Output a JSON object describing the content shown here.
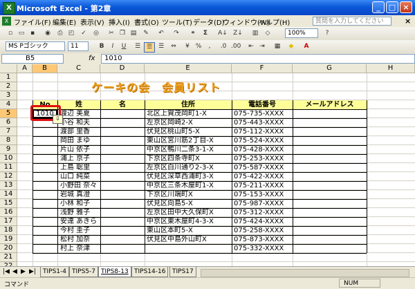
{
  "window": {
    "title": "Microsoft Excel - 第2章",
    "app_icon": "X"
  },
  "menu": {
    "items": [
      "ファイル(F)",
      "編集(E)",
      "表示(V)",
      "挿入(I)",
      "書式(O)",
      "ツール(T)",
      "データ(D)",
      "ウィンドウ(W)",
      "ヘルプ(H)"
    ],
    "help_placeholder": "質問を入力してください",
    "close_glyph": "×"
  },
  "toolbar": {
    "zoom": "100%",
    "font_name": "MS Pゴシック",
    "font_size": "11",
    "bold": "B",
    "italic": "I",
    "underline": "U",
    "percent": "%",
    "comma": ",",
    "sum": "Σ",
    "sort_asc": "A↓",
    "sort_desc": "Z↓"
  },
  "formula_bar": {
    "name_box": "B5",
    "fx": "fx",
    "value": "1010"
  },
  "columns": [
    "A",
    "B",
    "C",
    "D",
    "E",
    "F",
    "G",
    "H"
  ],
  "rows": [
    "1",
    "2",
    "3",
    "4",
    "5",
    "6",
    "7",
    "8",
    "9",
    "10",
    "11",
    "12",
    "13",
    "14",
    "15",
    "16",
    "17",
    "18",
    "19",
    "20",
    "21",
    "22"
  ],
  "sheet": {
    "title": "ケーキの会　会員リスト",
    "headers": {
      "no": "No",
      "sei": "姓",
      "mei": "名",
      "address": "住所",
      "phone": "電話番号",
      "email": "メールアドレス"
    },
    "b5_value": "1010",
    "records": [
      {
        "name": "渡辺 美夏",
        "address": "北区上賀茂岡町1-X",
        "phone": "075-735-XXXX"
      },
      {
        "name": "小谷 和夫",
        "address": "左京区岡崎2-X",
        "phone": "075-443-XXXX"
      },
      {
        "name": "渡部 里香",
        "address": "伏見区桃山町5-X",
        "phone": "075-112-XXXX"
      },
      {
        "name": "岡田 まゆ",
        "address": "東山区宮川筋2丁目-X",
        "phone": "075-524-XXXX"
      },
      {
        "name": "片山 依子",
        "address": "中京区鴨川二条3-1-X",
        "phone": "075-428-XXXX"
      },
      {
        "name": "浦上 京子",
        "address": "下京区四条寺町X",
        "phone": "075-253-XXXX"
      },
      {
        "name": "上島 聡里",
        "address": "左京区白川通り2-3-X",
        "phone": "075-587-XXXX"
      },
      {
        "name": "山口 純菜",
        "address": "伏見区深草西浦町3-X",
        "phone": "075-422-XXXX"
      },
      {
        "name": "小野田 奈々",
        "address": "中京区三条木屋町1-X",
        "phone": "075-211-XXXX"
      },
      {
        "name": "岩城 真澄",
        "address": "下京区川端町X",
        "phone": "075-153-XXXX"
      },
      {
        "name": "小林 和子",
        "address": "伏見区向島5-X",
        "phone": "075-987-XXXX"
      },
      {
        "name": "浅野 雅子",
        "address": "左京区田中大久保町X",
        "phone": "075-312-XXXX"
      },
      {
        "name": "安達 あきら",
        "address": "中京区東木屋町4-3-X",
        "phone": "075-424-XXXX"
      },
      {
        "name": "今村 圭子",
        "address": "東山区本町5-X",
        "phone": "075-258-XXXX"
      },
      {
        "name": "松村 加奈",
        "address": "伏見区中島外山町X",
        "phone": "075-873-XXXX"
      },
      {
        "name": "村上 奈津",
        "address": "",
        "phone": "075-332-XXXX"
      }
    ]
  },
  "smart_tag_glyph": "⇩",
  "tabs": [
    {
      "label": "TIPS1-4",
      "active": false
    },
    {
      "label": "TIPS5-7",
      "active": false
    },
    {
      "label": "TIPS8-13",
      "active": true
    },
    {
      "label": "TIPS14-16",
      "active": false
    },
    {
      "label": "TIPS17",
      "active": false
    }
  ],
  "status": {
    "mode": "コマンド",
    "num": "NUM"
  },
  "colors": {
    "title_orange": "#f0a020",
    "header_yellow": "#ffff99",
    "highlight_red": "#e01010",
    "titlebar_blue": "#0a58d8"
  }
}
